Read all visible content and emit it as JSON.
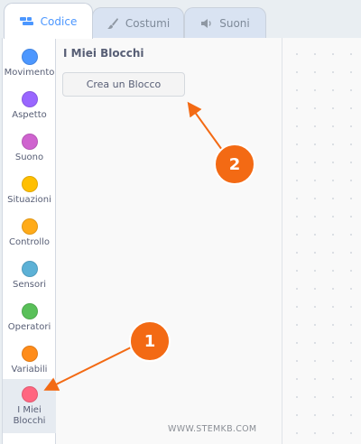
{
  "tabs": [
    {
      "label": "Codice",
      "icon": "code-icon",
      "active": true
    },
    {
      "label": "Costumi",
      "icon": "brush-icon",
      "active": false
    },
    {
      "label": "Suoni",
      "icon": "speaker-icon",
      "active": false
    }
  ],
  "categories": [
    {
      "label": "Movimento",
      "color": "#4c97ff"
    },
    {
      "label": "Aspetto",
      "color": "#9966ff"
    },
    {
      "label": "Suono",
      "color": "#cf63cf"
    },
    {
      "label": "Situazioni",
      "color": "#ffbf00"
    },
    {
      "label": "Controllo",
      "color": "#ffab19"
    },
    {
      "label": "Sensori",
      "color": "#5cb1d6"
    },
    {
      "label": "Operatori",
      "color": "#59c059"
    },
    {
      "label": "Variabili",
      "color": "#ff8c1a"
    },
    {
      "label": "I Miei\nBlocchi",
      "color": "#ff6680",
      "selected": true
    }
  ],
  "palette": {
    "title": "I Miei Blocchi",
    "make_block_label": "Crea un Blocco"
  },
  "watermark": "WWW.STEMKB.COM",
  "annotations": [
    {
      "number": "1"
    },
    {
      "number": "2"
    }
  ],
  "colors": {
    "accent": "#4c97ff",
    "annotation": "#f36a14"
  }
}
